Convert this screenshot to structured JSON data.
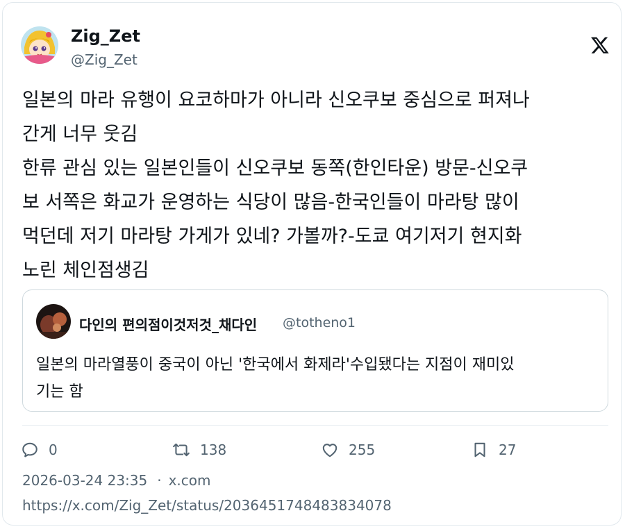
{
  "author": {
    "display_name": "Zig_Zet",
    "handle": "@Zig_Zet"
  },
  "brand_icon": "x-logo-icon",
  "tweet": {
    "lines": [
      "일본의 마라 유행이 요코하마가 아니라 신오쿠보 중심으로 퍼져나",
      "간게 너무 웃김",
      "한류 관심 있는 일본인들이 신오쿠보 동쪽(한인타운) 방문-신오쿠",
      "보 서쪽은 화교가 운영하는 식당이 많음-한국인들이 마라탕 많이",
      "먹던데 저기 마라탕 가게가 있네? 가볼까?-도쿄 여기저기 현지화",
      "노린 체인점생김"
    ]
  },
  "quote": {
    "display_name": "다인의 편의점이것저것_채다인",
    "handle": "@totheno1",
    "lines": [
      "일본의 마라열풍이 중국이 아닌 '한국에서 화제라'수입됐다는 지점이 재미있",
      "기는 함"
    ]
  },
  "actions": {
    "replies": "0",
    "retweets": "138",
    "likes": "255",
    "bookmarks": "27"
  },
  "meta": {
    "timestamp": "2026-03-24 23:35",
    "separator": "·",
    "source": "x.com",
    "url": "https://x.com/Zig_Zet/status/2036451748483834078"
  },
  "colors": {
    "text": "#0f1419",
    "secondary": "#536471",
    "border": "#cfd9de"
  }
}
